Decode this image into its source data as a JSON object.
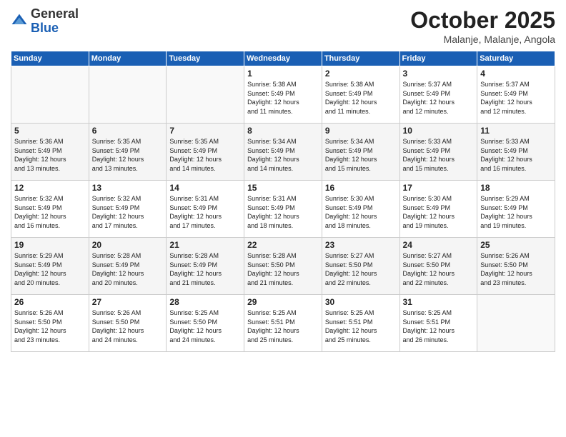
{
  "header": {
    "logo_general": "General",
    "logo_blue": "Blue",
    "month_title": "October 2025",
    "location": "Malanje, Malanje, Angola"
  },
  "weekdays": [
    "Sunday",
    "Monday",
    "Tuesday",
    "Wednesday",
    "Thursday",
    "Friday",
    "Saturday"
  ],
  "weeks": [
    [
      {
        "day": "",
        "info": ""
      },
      {
        "day": "",
        "info": ""
      },
      {
        "day": "",
        "info": ""
      },
      {
        "day": "1",
        "info": "Sunrise: 5:38 AM\nSunset: 5:49 PM\nDaylight: 12 hours\nand 11 minutes."
      },
      {
        "day": "2",
        "info": "Sunrise: 5:38 AM\nSunset: 5:49 PM\nDaylight: 12 hours\nand 11 minutes."
      },
      {
        "day": "3",
        "info": "Sunrise: 5:37 AM\nSunset: 5:49 PM\nDaylight: 12 hours\nand 12 minutes."
      },
      {
        "day": "4",
        "info": "Sunrise: 5:37 AM\nSunset: 5:49 PM\nDaylight: 12 hours\nand 12 minutes."
      }
    ],
    [
      {
        "day": "5",
        "info": "Sunrise: 5:36 AM\nSunset: 5:49 PM\nDaylight: 12 hours\nand 13 minutes."
      },
      {
        "day": "6",
        "info": "Sunrise: 5:35 AM\nSunset: 5:49 PM\nDaylight: 12 hours\nand 13 minutes."
      },
      {
        "day": "7",
        "info": "Sunrise: 5:35 AM\nSunset: 5:49 PM\nDaylight: 12 hours\nand 14 minutes."
      },
      {
        "day": "8",
        "info": "Sunrise: 5:34 AM\nSunset: 5:49 PM\nDaylight: 12 hours\nand 14 minutes."
      },
      {
        "day": "9",
        "info": "Sunrise: 5:34 AM\nSunset: 5:49 PM\nDaylight: 12 hours\nand 15 minutes."
      },
      {
        "day": "10",
        "info": "Sunrise: 5:33 AM\nSunset: 5:49 PM\nDaylight: 12 hours\nand 15 minutes."
      },
      {
        "day": "11",
        "info": "Sunrise: 5:33 AM\nSunset: 5:49 PM\nDaylight: 12 hours\nand 16 minutes."
      }
    ],
    [
      {
        "day": "12",
        "info": "Sunrise: 5:32 AM\nSunset: 5:49 PM\nDaylight: 12 hours\nand 16 minutes."
      },
      {
        "day": "13",
        "info": "Sunrise: 5:32 AM\nSunset: 5:49 PM\nDaylight: 12 hours\nand 17 minutes."
      },
      {
        "day": "14",
        "info": "Sunrise: 5:31 AM\nSunset: 5:49 PM\nDaylight: 12 hours\nand 17 minutes."
      },
      {
        "day": "15",
        "info": "Sunrise: 5:31 AM\nSunset: 5:49 PM\nDaylight: 12 hours\nand 18 minutes."
      },
      {
        "day": "16",
        "info": "Sunrise: 5:30 AM\nSunset: 5:49 PM\nDaylight: 12 hours\nand 18 minutes."
      },
      {
        "day": "17",
        "info": "Sunrise: 5:30 AM\nSunset: 5:49 PM\nDaylight: 12 hours\nand 19 minutes."
      },
      {
        "day": "18",
        "info": "Sunrise: 5:29 AM\nSunset: 5:49 PM\nDaylight: 12 hours\nand 19 minutes."
      }
    ],
    [
      {
        "day": "19",
        "info": "Sunrise: 5:29 AM\nSunset: 5:49 PM\nDaylight: 12 hours\nand 20 minutes."
      },
      {
        "day": "20",
        "info": "Sunrise: 5:28 AM\nSunset: 5:49 PM\nDaylight: 12 hours\nand 20 minutes."
      },
      {
        "day": "21",
        "info": "Sunrise: 5:28 AM\nSunset: 5:49 PM\nDaylight: 12 hours\nand 21 minutes."
      },
      {
        "day": "22",
        "info": "Sunrise: 5:28 AM\nSunset: 5:50 PM\nDaylight: 12 hours\nand 21 minutes."
      },
      {
        "day": "23",
        "info": "Sunrise: 5:27 AM\nSunset: 5:50 PM\nDaylight: 12 hours\nand 22 minutes."
      },
      {
        "day": "24",
        "info": "Sunrise: 5:27 AM\nSunset: 5:50 PM\nDaylight: 12 hours\nand 22 minutes."
      },
      {
        "day": "25",
        "info": "Sunrise: 5:26 AM\nSunset: 5:50 PM\nDaylight: 12 hours\nand 23 minutes."
      }
    ],
    [
      {
        "day": "26",
        "info": "Sunrise: 5:26 AM\nSunset: 5:50 PM\nDaylight: 12 hours\nand 23 minutes."
      },
      {
        "day": "27",
        "info": "Sunrise: 5:26 AM\nSunset: 5:50 PM\nDaylight: 12 hours\nand 24 minutes."
      },
      {
        "day": "28",
        "info": "Sunrise: 5:25 AM\nSunset: 5:50 PM\nDaylight: 12 hours\nand 24 minutes."
      },
      {
        "day": "29",
        "info": "Sunrise: 5:25 AM\nSunset: 5:51 PM\nDaylight: 12 hours\nand 25 minutes."
      },
      {
        "day": "30",
        "info": "Sunrise: 5:25 AM\nSunset: 5:51 PM\nDaylight: 12 hours\nand 25 minutes."
      },
      {
        "day": "31",
        "info": "Sunrise: 5:25 AM\nSunset: 5:51 PM\nDaylight: 12 hours\nand 26 minutes."
      },
      {
        "day": "",
        "info": ""
      }
    ]
  ]
}
